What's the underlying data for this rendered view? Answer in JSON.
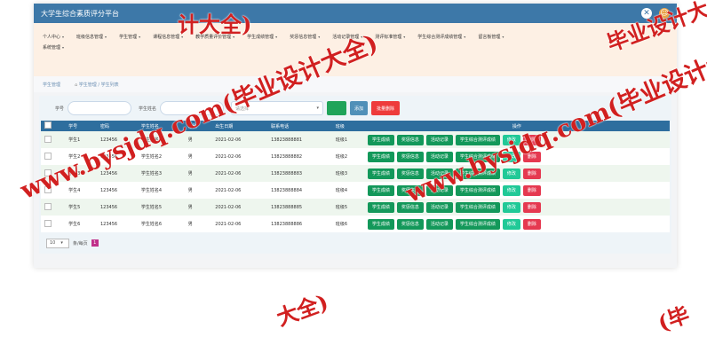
{
  "app": {
    "title": "大学生综合素质评分平台"
  },
  "icons": {
    "close": "close-icon",
    "avatar": "avatar-icon",
    "home": "home-icon",
    "caret": "chevron-down-icon"
  },
  "nav": {
    "row1": [
      "个人中心",
      "班级信息管理",
      "学生管理",
      "课程信息管理",
      "教学质量评价管理",
      "学生成绩管理",
      "奖惩信息管理",
      "活动记录管理",
      "测评标准管理",
      "学生综合测评成绩管理",
      "留言板管理"
    ],
    "row2": [
      "系统管理"
    ]
  },
  "breadcrumb": {
    "section": "学生管理",
    "path": "学生管理 / 学生列表"
  },
  "search": {
    "student_id_label": "学号",
    "student_name_label": "学生姓名",
    "select_placeholder": "请选择",
    "search_button": "查询",
    "add_button": "添加",
    "batch_delete_button": "批量删除"
  },
  "table": {
    "headers": [
      "学号",
      "密码",
      "学生姓名",
      "性别",
      "出生日期",
      "联系电话",
      "班级",
      "操作"
    ],
    "rows": [
      {
        "id": "学生1",
        "password": "123456",
        "name": "学生姓名1",
        "gender": "男",
        "birth": "2021-02-06",
        "phone": "13823888881",
        "class": "班级1"
      },
      {
        "id": "学生2",
        "password": "123456",
        "name": "学生姓名2",
        "gender": "男",
        "birth": "2021-02-06",
        "phone": "13823888882",
        "class": "班级2"
      },
      {
        "id": "学生3",
        "password": "123456",
        "name": "学生姓名3",
        "gender": "男",
        "birth": "2021-02-06",
        "phone": "13823888883",
        "class": "班级3"
      },
      {
        "id": "学生4",
        "password": "123456",
        "name": "学生姓名4",
        "gender": "男",
        "birth": "2021-02-06",
        "phone": "13823888884",
        "class": "班级4"
      },
      {
        "id": "学生5",
        "password": "123456",
        "name": "学生姓名5",
        "gender": "男",
        "birth": "2021-02-06",
        "phone": "13823888885",
        "class": "班级5"
      },
      {
        "id": "学生6",
        "password": "123456",
        "name": "学生姓名6",
        "gender": "男",
        "birth": "2021-02-06",
        "phone": "13823888886",
        "class": "班级6"
      }
    ],
    "actions": [
      "学生成绩",
      "奖惩信息",
      "活动记录",
      "学生综合测评成绩",
      "修改",
      "删除"
    ]
  },
  "pagination": {
    "page_size": "10",
    "per_page_label": "条/每页",
    "current_page": "1"
  },
  "watermark": {
    "text": "www.bysjdq.com(毕业设计大全)",
    "color": "#d12020"
  }
}
